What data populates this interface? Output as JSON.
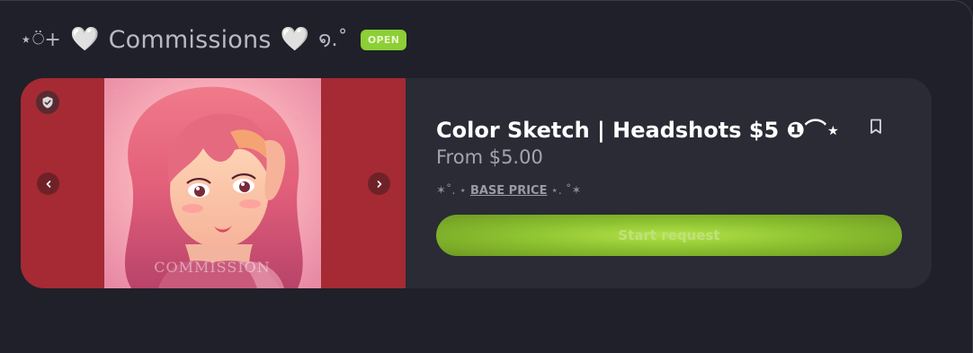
{
  "header": {
    "deco_left": "⋆⍥+",
    "heart_left": "🤍",
    "title": "Commissions",
    "heart_right": "🤍",
    "deco_right": "໑.˚",
    "status_badge": "OPEN"
  },
  "colors": {
    "background": "#1f2029",
    "card": "#2a2b35",
    "gallery_bg": "#a52a33",
    "accent_green": "#8ccf36"
  },
  "commission": {
    "title": "Color Sketch | Headshots $5 ❶⌒⋆",
    "price": "From $5.00",
    "subtitle_prefix": "✶˚. ⋆ ",
    "subtitle_main": "BASE PRICE",
    "subtitle_suffix": " ⋆. ˚✶",
    "cta_label": "Start request",
    "artwork_watermark": "COMMISSION"
  },
  "icons": {
    "verified": "shield-check-icon",
    "prev": "chevron-left-icon",
    "next": "chevron-right-icon",
    "bookmark": "bookmark-icon"
  }
}
